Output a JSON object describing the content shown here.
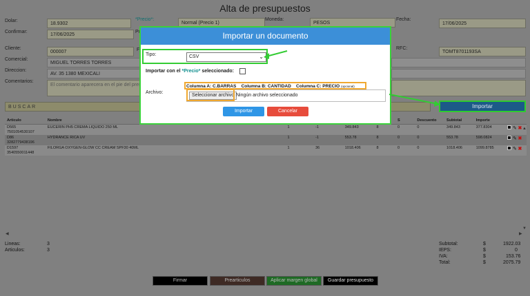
{
  "page": {
    "title": "Alta de presupuestos"
  },
  "form": {
    "dolar_label": "Dolar:",
    "dolar_value": "18.9302",
    "precio_label": "*Precio*:",
    "precio_value": "Normal (Precio 1)",
    "moneda_label": "Moneda:",
    "moneda_value": "PESOS",
    "fecha_label": "Fecha:",
    "fecha_value": "17/06/2025",
    "confirmar_label": "Confirmar:",
    "confirmar_value": "17/06/2025",
    "precio_short": "Pr",
    "cliente_label": "Cliente:",
    "cliente_value": "000007",
    "cliente_f": "F",
    "rfc_label": "RFC:",
    "rfc_value": "TOMT8701193SA",
    "comercial_label": "Comercial:",
    "comercial_value": "MIGUEL TORRES TORRES",
    "direccion_label": "Direccion:",
    "direccion_value": "AV. 35 1380 MEXICALI",
    "comentarios_label": "Comentarios:",
    "comentarios_placeholder": "El comentario aparecera en el pie del pres"
  },
  "buscar": {
    "label": "BUSCAR"
  },
  "import_button": "Importar",
  "table": {
    "headers": [
      "Articulo",
      "Nombre",
      "",
      "",
      "",
      "",
      "",
      "Descuento",
      "Subtotal",
      "Importe"
    ],
    "header_partial": "S",
    "rows": [
      {
        "code": "D565",
        "barcode": "7501054530107",
        "name": "EUCERIN PH5 CREMA LIQUIDO 250 ML",
        "c1": "1",
        "c2": "-1",
        "c3": "349.843",
        "c4": "8",
        "c5": "0",
        "c6": "0",
        "sub": "349.843",
        "imp": "377.8304"
      },
      {
        "code": "D86",
        "barcode": "3282779438196",
        "name": "HYDRANCE RICA UV",
        "c1": "1",
        "c2": "-1",
        "c3": "553.78",
        "c4": "8",
        "c5": "0",
        "c6": "0",
        "sub": "553.78",
        "imp": "598.0824"
      },
      {
        "code": "D1597",
        "barcode": "3540550011448",
        "name": "FILORGA OXYGEN-GLOW CC CREAM SPF30 40ML",
        "c1": "1",
        "c2": "36",
        "c3": "1018.406",
        "c4": "8",
        "c5": "0",
        "c6": "0",
        "sub": "1018.406",
        "imp": "1099.8785"
      }
    ]
  },
  "summary": {
    "lineas_label": "Lineas:",
    "lineas_value": "3",
    "articulos_label": "Articulos:",
    "articulos_value": "3",
    "currency": "$",
    "subtotal_label": "Subtotal:",
    "subtotal_value": "1922.03",
    "ieps_label": "IEPS:",
    "ieps_value": "0",
    "iva_label": "IVA:",
    "iva_value": "153.76",
    "total_label": "Total:",
    "total_value": "2075.79"
  },
  "bottom_buttons": {
    "firmar": "Firmar",
    "prearticulos": "Prearticulos",
    "margen": "Aplicar margen global",
    "guardar": "Guardar presupuesto"
  },
  "modal": {
    "title": "Importar un documento",
    "tipo_label": "Tipo:",
    "tipo_value": "CSV",
    "importar_precio_prefix": "Importar con el ",
    "importar_precio_highlight": "*Precio*",
    "importar_precio_suffix": " seleccionado:",
    "archivo_label": "Archivo:",
    "col_a": "Columna A: C.BARRAS",
    "col_b": "Columna B: CANTIDAD",
    "col_c": "Columna C: PRECIO",
    "col_c_opt": "(opcional)",
    "file_button": "Seleccionar archivo",
    "file_status": "Ningún archivo seleccionado",
    "importar_button": "Importar",
    "cancelar_button": "Cancelar"
  },
  "colors": {
    "modal_header": "#3c8fd8",
    "highlight_green": "#33cc33",
    "highlight_orange": "#f0a830",
    "import_bg": "#1c5a88",
    "cancel_red": "#e74c3c",
    "precio_teal": "#0e6e6e"
  }
}
